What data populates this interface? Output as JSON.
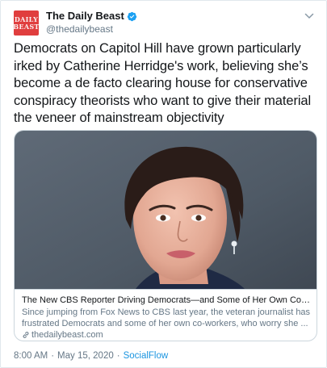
{
  "account": {
    "display_name": "The Daily Beast",
    "handle": "@thedailybeast",
    "avatar_text": [
      "DAILY",
      "BEAST"
    ],
    "verified": true
  },
  "tweet": {
    "lines": [
      "Democrats on Capitol Hill have grown particularly",
      "irked by Catherine Herridge's work, believing she’s",
      "become a de facto clearing house for conservative",
      "conspiracy theorists who want to give their material",
      "the veneer of mainstream objectivity"
    ]
  },
  "card": {
    "image_alt": "photo-woman-short-dark-hair",
    "title": "The New CBS Reporter Driving Democrats—and Some of Her Own Collea...",
    "description_lines": [
      "Since jumping from Fox News to CBS last year, the veteran journalist has",
      "frustrated Democrats and some of her own co-workers, who worry she ..."
    ],
    "domain": "thedailybeast.com"
  },
  "meta": {
    "time": "8:00 AM",
    "date": "May 15, 2020",
    "separator": "·",
    "source": "SocialFlow"
  },
  "colors": {
    "brand_red": "#e03e3e",
    "verified_blue": "#1da1f2",
    "link_blue": "#1b95e0",
    "secondary_text": "#657786"
  },
  "icons": {
    "verified": "verified-badge-icon",
    "chevron": "chevron-down-icon",
    "link": "link-icon"
  }
}
